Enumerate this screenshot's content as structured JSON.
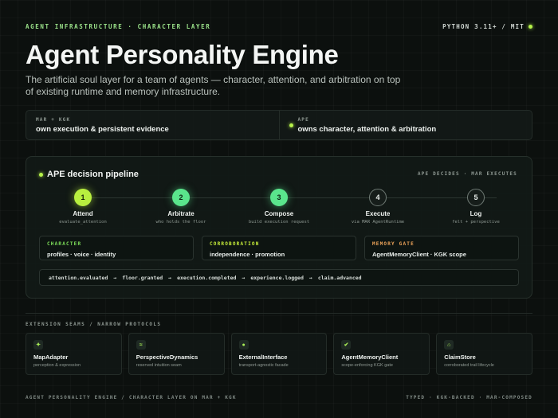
{
  "header": {
    "eyebrow": "AGENT INFRASTRUCTURE · CHARACTER LAYER",
    "version": "PYTHON 3.11+ / MIT",
    "title": "Agent Personality Engine",
    "subtitle": "The artificial soul layer for a team of agents — character, attention, and arbitration on top of existing runtime and memory infrastructure."
  },
  "split": {
    "left": {
      "tag": "MAR + KGK",
      "text": "own execution & persistent evidence"
    },
    "right": {
      "tag": "APE",
      "text": "owns character, attention & arbitration"
    }
  },
  "pipeline": {
    "title": "APE decision pipeline",
    "side": "APE DECIDES · MAR EXECUTES",
    "steps": [
      {
        "num": "1",
        "name": "Attend",
        "desc": "evaluate_attention"
      },
      {
        "num": "2",
        "name": "Arbitrate",
        "desc": "who holds the floor"
      },
      {
        "num": "3",
        "name": "Compose",
        "desc": "build execution request"
      },
      {
        "num": "4",
        "name": "Execute",
        "desc": "via MAR AgentRuntime"
      },
      {
        "num": "5",
        "name": "Log",
        "desc": "felt + perspective"
      }
    ],
    "cards": [
      {
        "label": "CHARACTER",
        "value": "profiles · voice · identity",
        "color": "#7ee05a"
      },
      {
        "label": "CORROBORATION",
        "value": "independence · promotion",
        "color": "#c8ef3a"
      },
      {
        "label": "MEMORY GATE",
        "value": "AgentMemoryClient · KGK scope",
        "color": "#f0a55a"
      }
    ],
    "events": [
      "attention.evaluated",
      "floor.granted",
      "execution.completed",
      "experience.logged",
      "claim.advanced"
    ],
    "arrow": "→"
  },
  "seams": {
    "title": "EXTENSION SEAMS / NARROW PROTOCOLS",
    "items": [
      {
        "icon": "✦",
        "name": "MapAdapter",
        "desc": "perception & expression"
      },
      {
        "icon": "≈",
        "name": "PerspectiveDynamics",
        "desc": "reserved intuition seam"
      },
      {
        "icon": "●",
        "name": "ExternalInterface",
        "desc": "transport-agnostic facade"
      },
      {
        "icon": "✔",
        "name": "AgentMemoryClient",
        "desc": "scope-enforcing KGK gate"
      },
      {
        "icon": "⌂",
        "name": "ClaimStore",
        "desc": "corroborated trail lifecycle"
      }
    ]
  },
  "footer": {
    "left": "AGENT PERSONALITY ENGINE / CHARACTER LAYER ON MAR + KGK",
    "right": "TYPED · KGK-BACKED · MAR-COMPOSED"
  },
  "colors": {
    "accent": "#b8ef3f",
    "green": "#5ae58c",
    "background": "#0c100e"
  }
}
